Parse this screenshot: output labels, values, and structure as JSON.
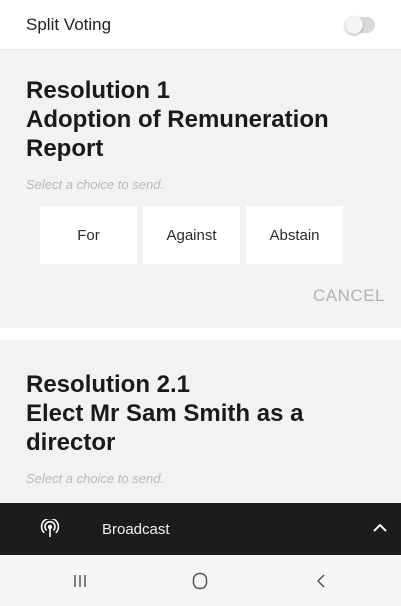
{
  "split_voting": {
    "label": "Split Voting",
    "enabled": false
  },
  "resolutions": [
    {
      "title_line1": "Resolution 1",
      "title_line2": "Adoption of Remuneration",
      "title_line3": "Report",
      "hint": "Select a choice to send.",
      "choices": [
        "For",
        "Against",
        "Abstain"
      ],
      "cancel_label": "CANCEL"
    },
    {
      "title_line1": "Resolution 2.1",
      "title_line2": "Elect Mr Sam Smith as a",
      "title_line3": "director",
      "hint": "Select a choice to send."
    }
  ],
  "broadcast": {
    "label": "Broadcast",
    "icon": "broadcast-icon",
    "chevron": "^"
  },
  "system_nav": {
    "recents": "recents-icon",
    "home": "home-icon",
    "back": "back-icon"
  }
}
